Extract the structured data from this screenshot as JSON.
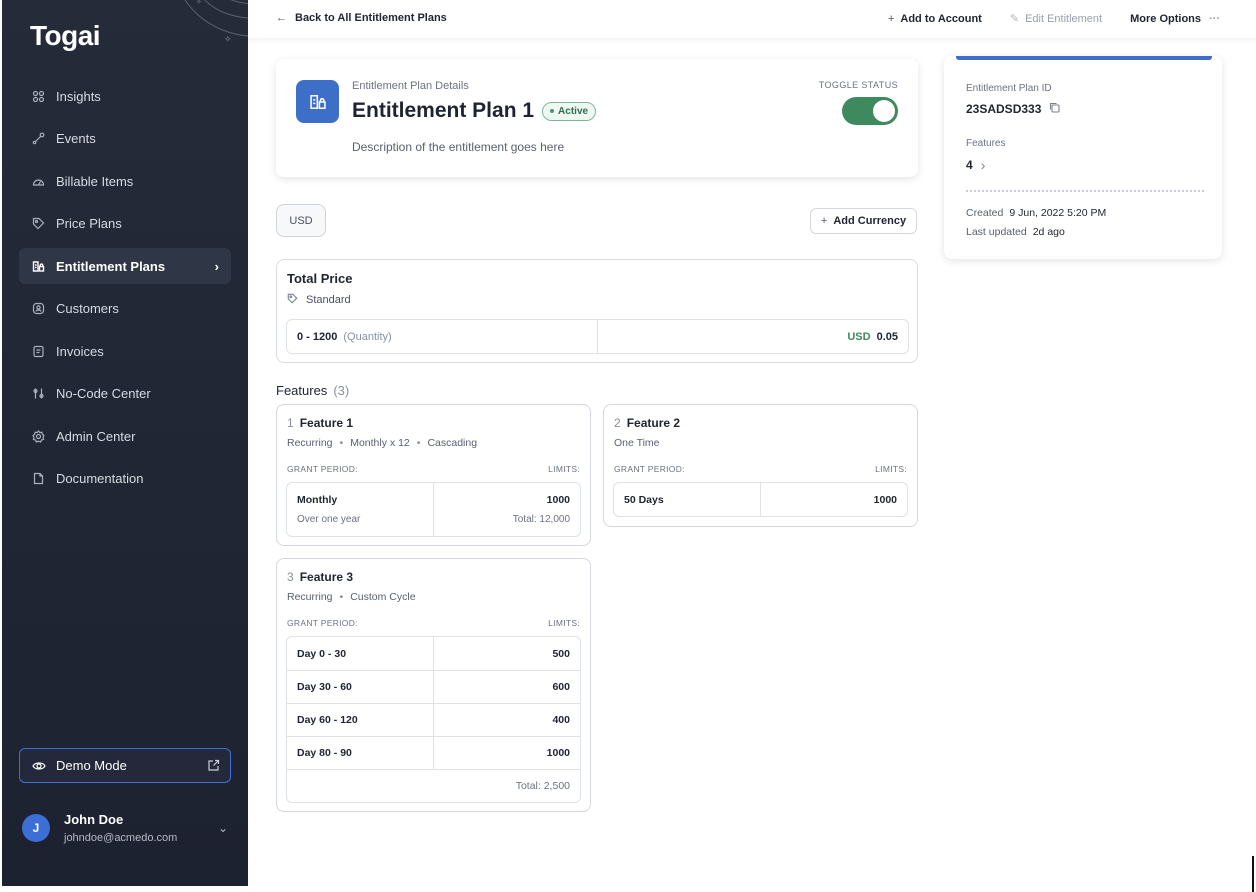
{
  "app": {
    "logo": "Togai"
  },
  "sidebar": {
    "items": [
      {
        "label": "Insights",
        "icon": "grid-icon"
      },
      {
        "label": "Events",
        "icon": "events-icon"
      },
      {
        "label": "Billable Items",
        "icon": "gauge-icon"
      },
      {
        "label": "Price Plans",
        "icon": "tag-icon"
      },
      {
        "label": "Entitlement Plans",
        "icon": "entitlement-icon",
        "active": true
      },
      {
        "label": "Customers",
        "icon": "customers-icon"
      },
      {
        "label": "Invoices",
        "icon": "invoice-icon"
      },
      {
        "label": "No-Code Center",
        "icon": "nocode-icon"
      },
      {
        "label": "Admin Center",
        "icon": "admin-icon"
      },
      {
        "label": "Documentation",
        "icon": "document-icon"
      }
    ],
    "demo_mode": "Demo Mode",
    "user": {
      "initial": "J",
      "name": "John Doe",
      "email": "johndoe@acmedo.com"
    }
  },
  "topbar": {
    "back": "Back to All Entitlement Plans",
    "add_to_account": "Add to Account",
    "edit_entitlement": "Edit Entitlement",
    "more_options": "More Options"
  },
  "plan": {
    "subtitle": "Entitlement Plan Details",
    "title": "Entitlement Plan 1",
    "status": "Active",
    "description": "Description of the entitlement goes here",
    "toggle_label": "TOGGLE STATUS",
    "toggle_on": true
  },
  "currency": {
    "selected": "USD",
    "add_label": "Add Currency"
  },
  "pricing": {
    "title": "Total Price",
    "model": "Standard",
    "range": "0 - 1200",
    "unit": "(Quantity)",
    "currency": "USD",
    "price": "0.05"
  },
  "features": {
    "heading": "Features",
    "count": "(3)",
    "grant_period_label": "GRANT PERIOD:",
    "limits_label": "LIMITS:",
    "list": [
      {
        "num": "1",
        "name": "Feature 1",
        "meta": [
          "Recurring",
          "Monthly x 12",
          "Cascading"
        ],
        "rows": [
          {
            "period": "Monthly",
            "period_sub": "Over one year",
            "limit": "1000",
            "limit_sub": "Total: 12,000"
          }
        ]
      },
      {
        "num": "2",
        "name": "Feature 2",
        "meta": [
          "One Time"
        ],
        "rows": [
          {
            "period": "50 Days",
            "limit": "1000"
          }
        ]
      },
      {
        "num": "3",
        "name": "Feature 3",
        "meta": [
          "Recurring",
          "Custom Cycle"
        ],
        "rows": [
          {
            "period": "Day 0 - 30",
            "limit": "500"
          },
          {
            "period": "Day 30 - 60",
            "limit": "600"
          },
          {
            "period": "Day 60 - 120",
            "limit": "400"
          },
          {
            "period": "Day 80 - 90",
            "limit": "1000"
          }
        ],
        "total": "Total: 2,500"
      }
    ]
  },
  "details": {
    "id_label": "Entitlement Plan ID",
    "id_value": "23SADSD333",
    "features_label": "Features",
    "features_value": "4",
    "created_label": "Created",
    "created_value": "9 Jun, 2022 5:20 PM",
    "updated_label": "Last updated",
    "updated_value": "2d ago"
  },
  "colors": {
    "accent": "#3d6fc9",
    "success": "#3e8a5e",
    "sidebar_bg": "#252b39"
  }
}
